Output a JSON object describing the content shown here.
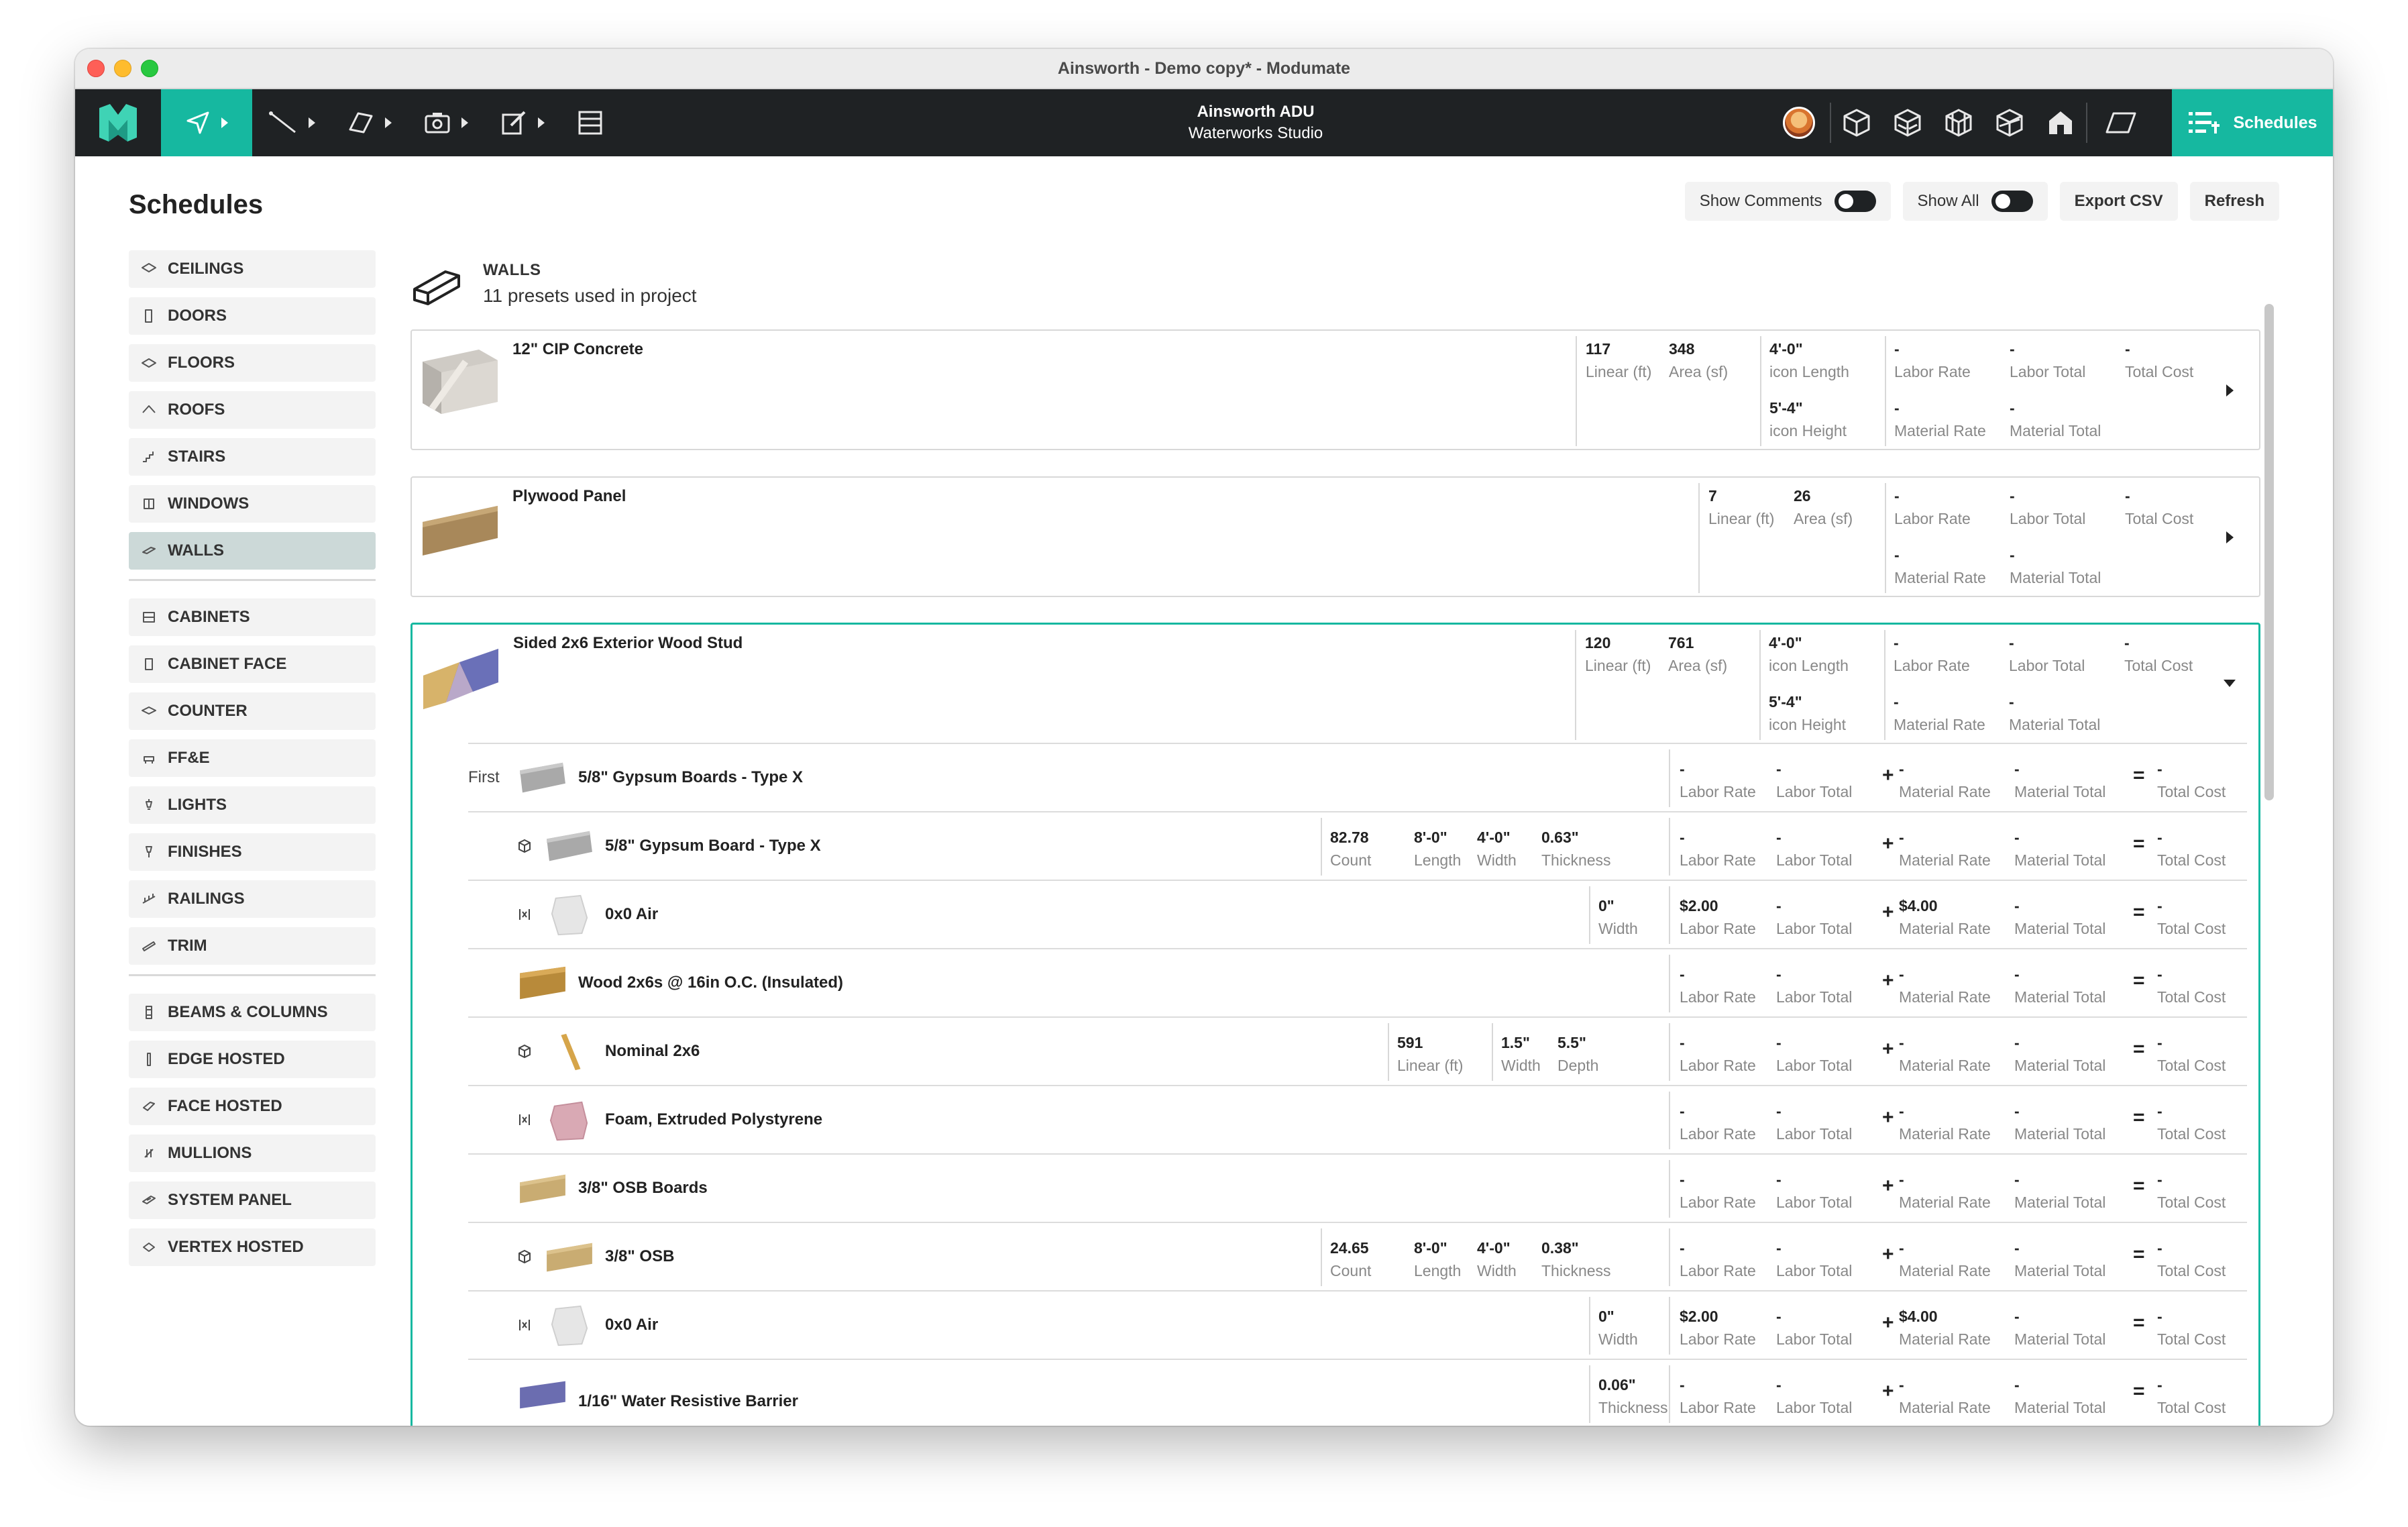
{
  "window": {
    "title": "Ainsworth - Demo copy* - Modumate"
  },
  "toolbar": {
    "project_name": "Ainsworth ADU",
    "studio_name": "Waterworks Studio",
    "schedules_label": "Schedules",
    "tools": [
      "select-icon",
      "line-icon",
      "plane-icon",
      "camera-icon",
      "edit-icon",
      "cabinet-icon"
    ],
    "views": [
      "cube-icon",
      "wall-view-icon",
      "wireframe-cube-icon",
      "section-cube-icon",
      "house-icon",
      "plan-view-icon"
    ]
  },
  "page": {
    "title": "Schedules",
    "show_comments": "Show Comments",
    "show_all": "Show All",
    "export_csv": "Export CSV",
    "refresh": "Refresh"
  },
  "sidebar": {
    "group1": [
      "CEILINGS",
      "DOORS",
      "FLOORS",
      "ROOFS",
      "STAIRS",
      "WINDOWS",
      "WALLS"
    ],
    "group2": [
      "CABINETS",
      "CABINET FACE",
      "COUNTER",
      "FF&E",
      "LIGHTS",
      "FINISHES",
      "RAILINGS",
      "TRIM"
    ],
    "group3": [
      "BEAMS & COLUMNS",
      "EDGE HOSTED",
      "FACE HOSTED",
      "MULLIONS",
      "SYSTEM PANEL",
      "VERTEX HOSTED"
    ],
    "selected": "WALLS"
  },
  "section": {
    "title": "WALLS",
    "subtitle": "11 presets used in project"
  },
  "labels": {
    "linear": "Linear (ft)",
    "area": "Area (sf)",
    "icon_length": "icon Length",
    "icon_height": "icon Height",
    "labor_rate": "Labor Rate",
    "labor_total": "Labor Total",
    "material_rate": "Material Rate",
    "material_total": "Material Total",
    "total_cost": "Total Cost",
    "count": "Count",
    "length": "Length",
    "width": "Width",
    "thickness": "Thickness",
    "depth": "Depth",
    "dash": "-",
    "plus": "+",
    "equals": "="
  },
  "cards": [
    {
      "name": "12\" CIP Concrete",
      "linear": "117",
      "area": "348",
      "length": "4'-0\"",
      "height": "5'-4\""
    },
    {
      "name": "Plywood Panel",
      "linear": "7",
      "area": "26"
    },
    {
      "name": "Sided 2x6 Exterior Wood Stud",
      "linear": "120",
      "area": "761",
      "length": "4'-0\"",
      "height": "5'-4\""
    }
  ],
  "layers": [
    {
      "name": "5/8\" Gypsum Boards - Type X",
      "layer_label": "First"
    },
    {
      "name": "5/8\" Gypsum Board - Type X",
      "count": "82.78",
      "length": "8'-0\"",
      "width": "4'-0\"",
      "thickness": "0.63\""
    },
    {
      "name": "0x0 Air",
      "width": "0\"",
      "labor_rate": "$2.00",
      "material_rate": "$4.00"
    },
    {
      "name": "Wood 2x6s @ 16in O.C. (Insulated)"
    },
    {
      "name": "Nominal 2x6",
      "linear": "591",
      "width": "1.5\"",
      "depth": "5.5\""
    },
    {
      "name": "Foam, Extruded Polystyrene"
    },
    {
      "name": "3/8\" OSB Boards"
    },
    {
      "name": "3/8\" OSB",
      "count": "24.65",
      "length": "8'-0\"",
      "width": "4'-0\"",
      "thickness": "0.38\""
    },
    {
      "name": "0x0 Air",
      "width": "0\"",
      "labor_rate": "$2.00",
      "material_rate": "$4.00"
    },
    {
      "name": "1/16\" Water Resistive Barrier",
      "thickness": "0.06\""
    }
  ]
}
